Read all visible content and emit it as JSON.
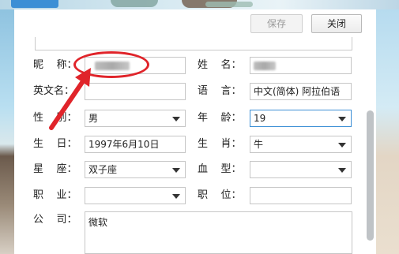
{
  "toolbar": {
    "save_label": "保存",
    "close_label": "关闭"
  },
  "form": {
    "nickname": {
      "label": "昵    称：",
      "value": ""
    },
    "name": {
      "label": "姓    名：",
      "value": ""
    },
    "english_name": {
      "label": "英文名：",
      "value": ""
    },
    "language": {
      "label": "语    言：",
      "value": "中文(简体)  阿拉伯语"
    },
    "gender": {
      "label": "性    别：",
      "value": "男"
    },
    "age": {
      "label": "年    龄：",
      "value": "19"
    },
    "birthday": {
      "label": "生    日：",
      "value": "1997年6月10日"
    },
    "zodiac": {
      "label": "生    肖：",
      "value": "牛"
    },
    "constellation": {
      "label": "星    座：",
      "value": "双子座"
    },
    "blood_type": {
      "label": "血    型：",
      "value": ""
    },
    "occupation": {
      "label": "职    业：",
      "value": ""
    },
    "position": {
      "label": "职    位：",
      "value": ""
    },
    "company": {
      "label": "公    司：",
      "value": "微软"
    }
  },
  "colors": {
    "annotation": "#e0242a",
    "focus": "#3c8fd5"
  }
}
